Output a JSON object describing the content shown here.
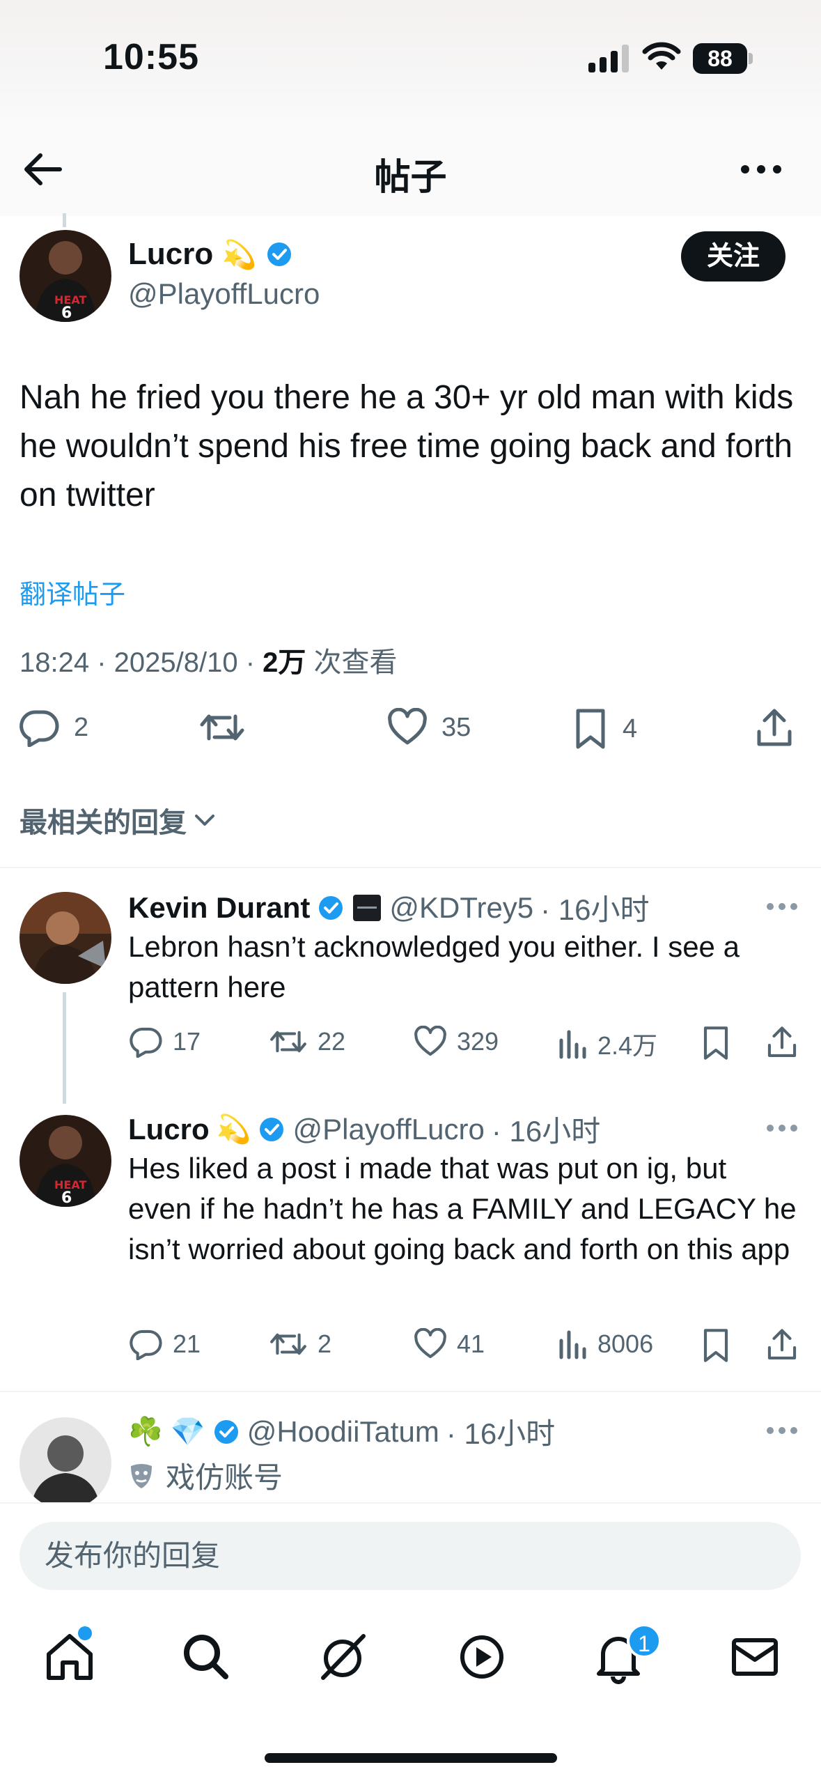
{
  "status_bar": {
    "time": "10:55",
    "battery": "88"
  },
  "header": {
    "title": "帖子"
  },
  "tweet": {
    "name": "Lucro",
    "emoji": "💫",
    "handle": "@PlayoffLucro",
    "follow_label": "关注",
    "text": "Nah he fried you there he a 30+ yr old man with kids he wouldn’t spend his free time going back and forth on twitter",
    "translate_label": "翻译帖子",
    "meta_time": "18:24 · 2025/8/10 · ",
    "views_count": "2万",
    "views_label": " 次查看",
    "actions": {
      "replies": "2",
      "retweets": "",
      "likes": "35",
      "bookmarks": "4"
    }
  },
  "sort": {
    "label": "最相关的回复"
  },
  "replies": [
    {
      "name": "Kevin Durant",
      "handle": "@KDTrey5",
      "time": "· 16小时",
      "text": "Lebron hasn’t acknowledged you either. I see a pattern here",
      "actions": {
        "replies": "17",
        "retweets": "22",
        "likes": "329",
        "views": "2.4万"
      }
    },
    {
      "name": "Lucro",
      "emoji": "💫",
      "handle": "@PlayoffLucro",
      "time": "· 16小时",
      "text": "Hes liked a post i made that was put on ig, but even if he hadn’t he has a FAMILY and LEGACY he isn’t worried about going back and forth on this app",
      "actions": {
        "replies": "21",
        "retweets": "2",
        "likes": "41",
        "views": "8006"
      }
    },
    {
      "emoji": "☘️ 💎",
      "handle": "@HoodiiTatum",
      "time": "· 16小时",
      "parody_label": "戏仿账号"
    }
  ],
  "reply_input": {
    "placeholder": "发布你的回复"
  },
  "tabs": [
    "home-icon",
    "search-icon",
    "grok-icon",
    "video-icon",
    "notifications-icon",
    "messages-icon"
  ],
  "notifications_badge": "1",
  "colors": {
    "accent": "#1d9bf0",
    "text": "#0f1419",
    "secondary": "#536471"
  }
}
